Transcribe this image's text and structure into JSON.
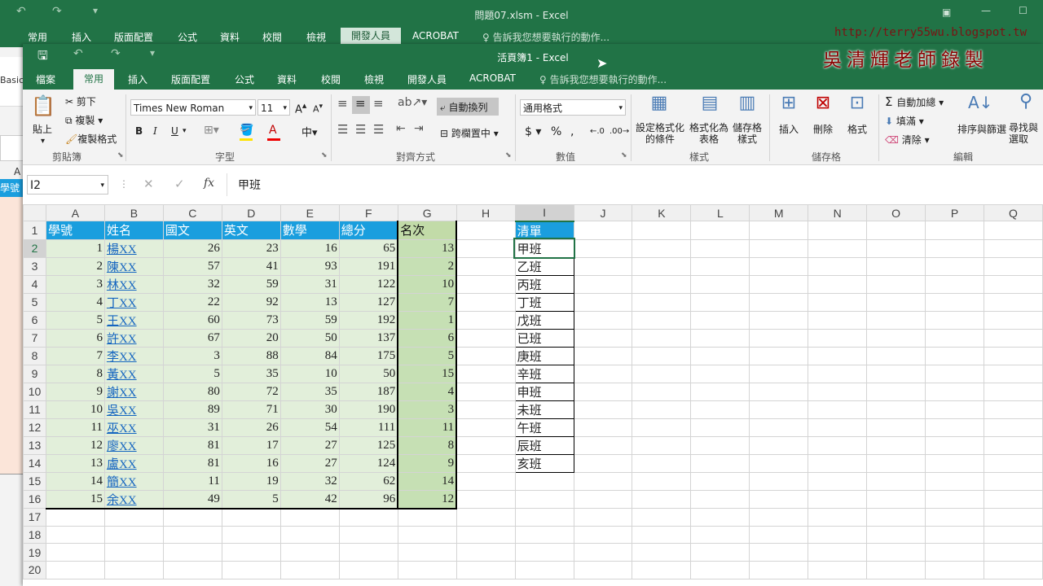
{
  "back_window": {
    "title": "問題07.xlsm - Excel",
    "tabs": [
      "常用",
      "插入",
      "版面配置",
      "公式",
      "資料",
      "校閱",
      "檢視",
      "開發人員",
      "ACROBAT"
    ],
    "tell_me": "告訴我您想要執行的動作...",
    "left_fragments": [
      "A",
      "Basic",
      "學號"
    ]
  },
  "watermark": {
    "url": "http://terry55wu.blogspot.tw",
    "text": "吳清輝老師錄製"
  },
  "window": {
    "title": "活頁簿1 - Excel",
    "tabs": [
      "檔案",
      "常用",
      "插入",
      "版面配置",
      "公式",
      "資料",
      "校閱",
      "檢視",
      "開發人員",
      "ACROBAT"
    ],
    "tell_me": "告訴我您想要執行的動作..."
  },
  "ribbon": {
    "clipboard": {
      "paste": "貼上",
      "cut": "剪下",
      "copy": "複製",
      "format_painter": "複製格式",
      "group": "剪貼簿"
    },
    "font": {
      "name": "Times New Roman",
      "size": "11",
      "group": "字型"
    },
    "alignment": {
      "wrap": "自動換列",
      "merge": "跨欄置中",
      "group": "對齊方式"
    },
    "number": {
      "format": "通用格式",
      "group": "數值"
    },
    "styles": {
      "conditional": "設定格式化的條件",
      "table": "格式化為表格",
      "cell": "儲存格樣式",
      "group": "樣式"
    },
    "cells": {
      "insert": "插入",
      "delete": "刪除",
      "format": "格式",
      "group": "儲存格"
    },
    "editing": {
      "autosum": "自動加總",
      "fill": "填滿",
      "clear": "清除",
      "sort": "排序與篩選",
      "find": "尋找與選取",
      "group": "編輯"
    }
  },
  "formula_bar": {
    "name_box": "I2",
    "content": "甲班"
  },
  "columns": [
    "A",
    "B",
    "C",
    "D",
    "E",
    "F",
    "G",
    "H",
    "I",
    "J",
    "K",
    "L",
    "M",
    "N",
    "O",
    "P",
    "Q"
  ],
  "headers": [
    "學號",
    "姓名",
    "國文",
    "英文",
    "數學",
    "總分",
    "名次"
  ],
  "rows": [
    [
      "1",
      "楊XX",
      "26",
      "23",
      "16",
      "65",
      "13"
    ],
    [
      "2",
      "陳XX",
      "57",
      "41",
      "93",
      "191",
      "2"
    ],
    [
      "3",
      "林XX",
      "32",
      "59",
      "31",
      "122",
      "10"
    ],
    [
      "4",
      "丁XX",
      "22",
      "92",
      "13",
      "127",
      "7"
    ],
    [
      "5",
      "王XX",
      "60",
      "73",
      "59",
      "192",
      "1"
    ],
    [
      "6",
      "許XX",
      "67",
      "20",
      "50",
      "137",
      "6"
    ],
    [
      "7",
      "李XX",
      "3",
      "88",
      "84",
      "175",
      "5"
    ],
    [
      "8",
      "黃XX",
      "5",
      "35",
      "10",
      "50",
      "15"
    ],
    [
      "9",
      "謝XX",
      "80",
      "72",
      "35",
      "187",
      "4"
    ],
    [
      "10",
      "吳XX",
      "89",
      "71",
      "30",
      "190",
      "3"
    ],
    [
      "11",
      "巫XX",
      "31",
      "26",
      "54",
      "111",
      "11"
    ],
    [
      "12",
      "廖XX",
      "81",
      "17",
      "27",
      "125",
      "8"
    ],
    [
      "13",
      "盧XX",
      "81",
      "16",
      "27",
      "124",
      "9"
    ],
    [
      "14",
      "簡XX",
      "11",
      "19",
      "32",
      "62",
      "14"
    ],
    [
      "15",
      "余XX",
      "49",
      "5",
      "42",
      "96",
      "12"
    ]
  ],
  "list": {
    "header": "清單",
    "items": [
      "甲班",
      "乙班",
      "丙班",
      "丁班",
      "戊班",
      "已班",
      "庚班",
      "辛班",
      "申班",
      "未班",
      "午班",
      "辰班",
      "亥班"
    ]
  },
  "row_count": 20,
  "colors": {
    "excel_green": "#217346",
    "header_blue": "#1a9ede",
    "data_fill": "#e2efda",
    "rank_fill": "#c6e0b4"
  }
}
